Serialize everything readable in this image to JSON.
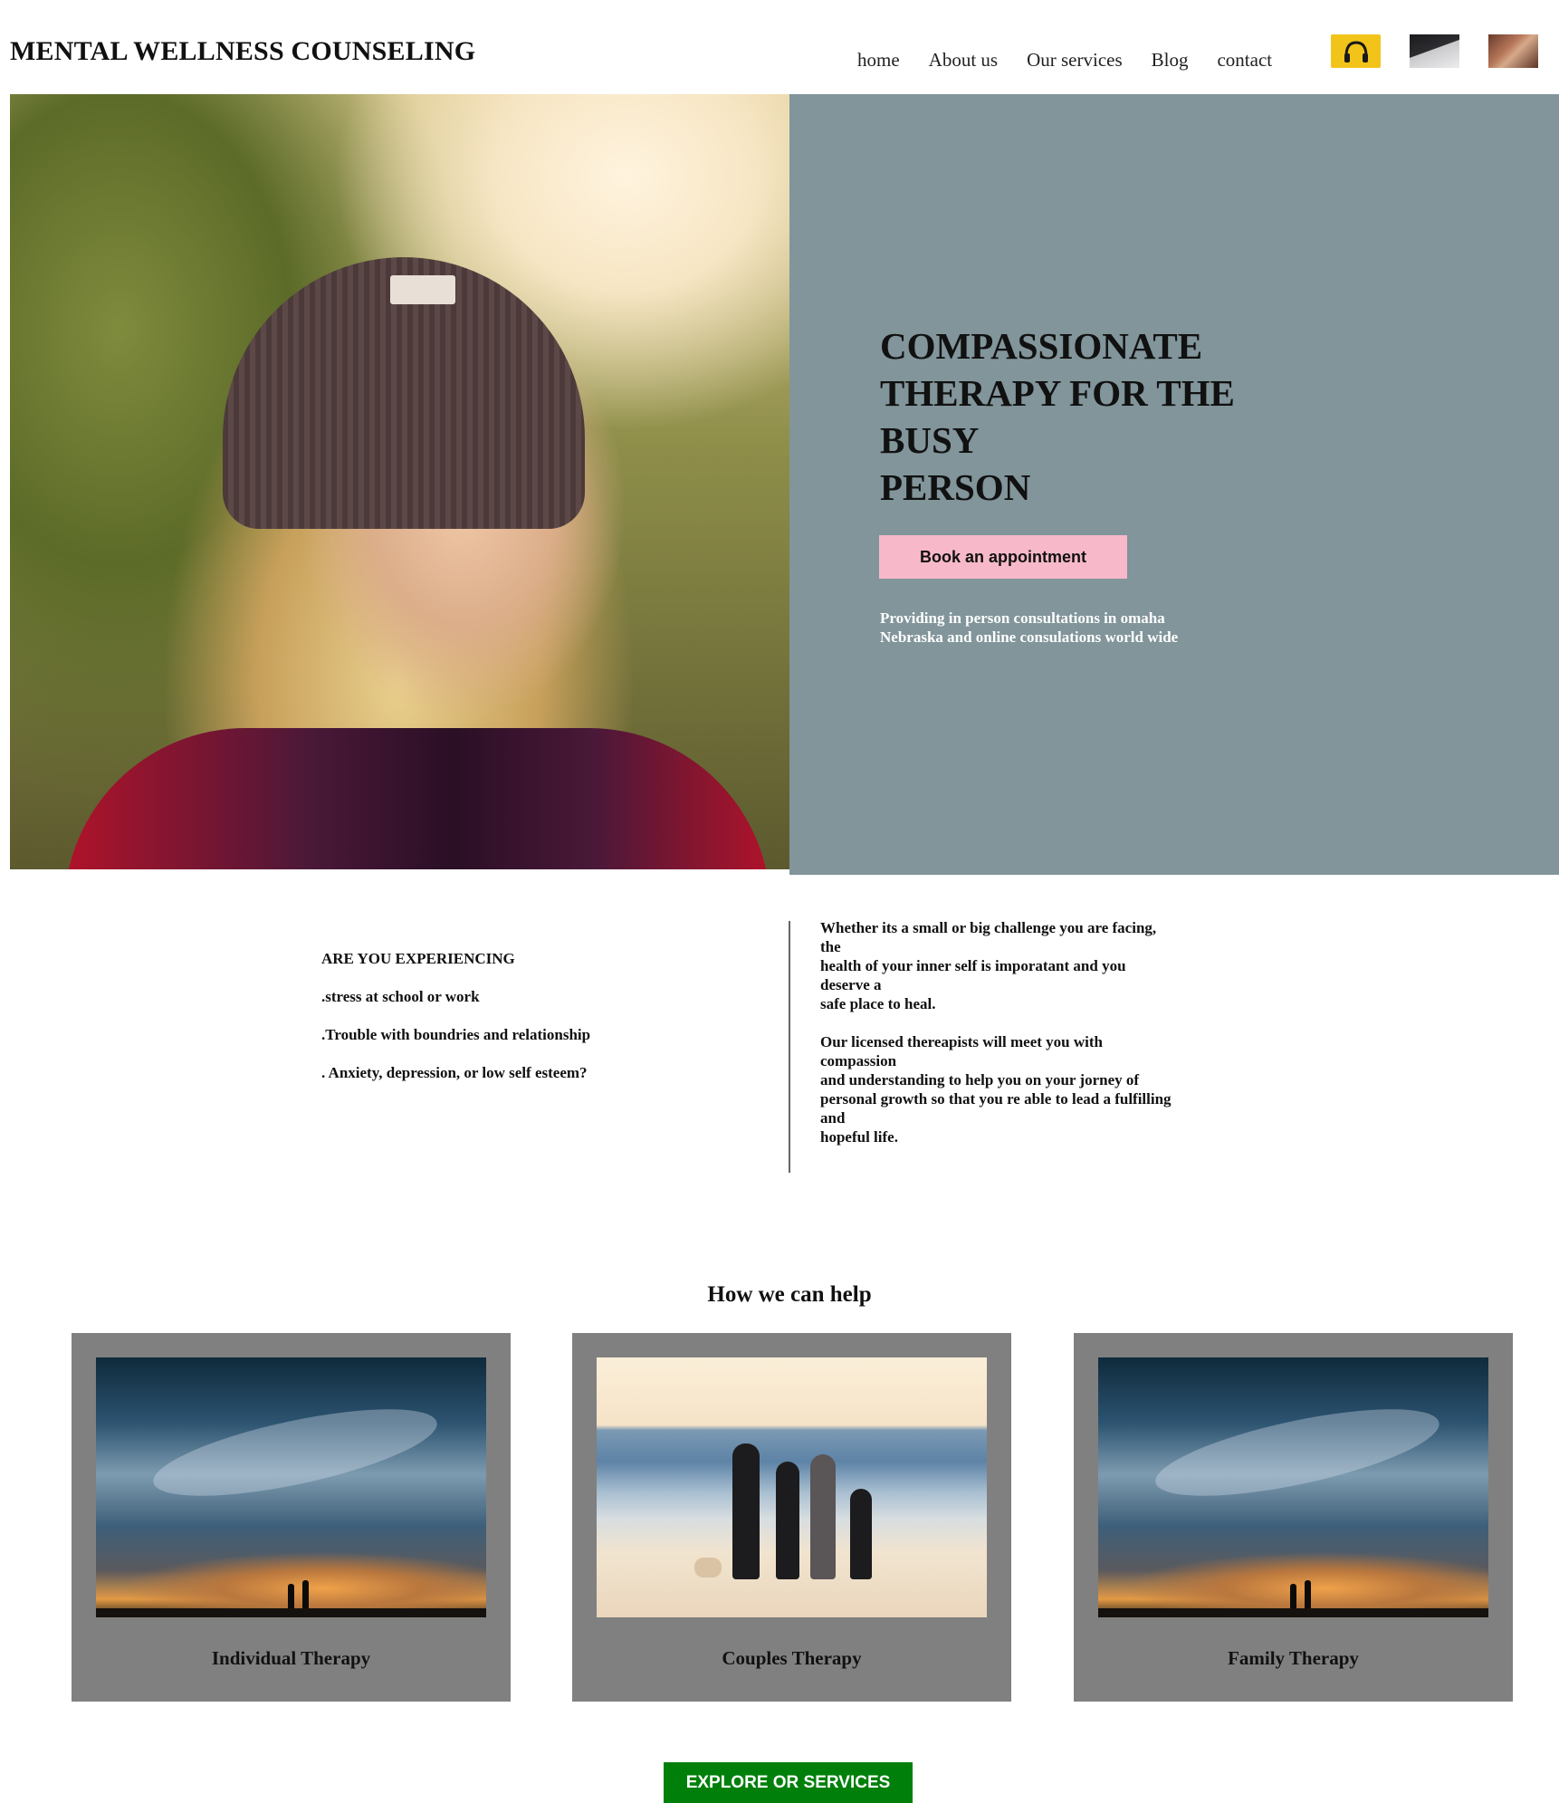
{
  "header": {
    "brand": "MENTAL WELLNESS COUNSELING",
    "nav": [
      "home",
      "About us",
      "Our services",
      "Blog",
      "contact"
    ],
    "thumbnails": [
      "headphones-icon",
      "laptop-icon",
      "photo-icon"
    ]
  },
  "hero": {
    "title_lines": [
      "COMPASSIONATE",
      "THERAPY FOR THE",
      "BUSY",
      "PERSON"
    ],
    "cta": "Book an appointment",
    "subtitle_lines": [
      "Providing in person consultations in omaha",
      "Nebraska and online consulations world wide"
    ]
  },
  "about": {
    "heading": "ARE YOU EXPERIENCING",
    "items": [
      ".stress at school or work",
      ".Trouble with boundries and relationship",
      ". Anxiety, depression, or low self esteem?"
    ],
    "paragraph1_lines": [
      "Whether its a small or big challenge you are facing,",
      "the",
      "health of your inner self is imporatant and you",
      "deserve a",
      "safe place to heal."
    ],
    "paragraph2_lines": [
      "Our licensed thereapists will meet you with",
      "compassion",
      "and understanding to help you on your jorney of",
      "personal growth so that you re able to lead a fulfilling",
      "and",
      "hopeful life."
    ]
  },
  "services": {
    "title": "How we can help",
    "cards": [
      {
        "label": "Individual Therapy"
      },
      {
        "label": "Couples Therapy"
      },
      {
        "label": "Family Therapy"
      }
    ],
    "cta": "EXPLORE OR SERVICES"
  },
  "colors": {
    "hero_panel": "#81959a",
    "book_button": "#f7b9c9",
    "card_bg": "#808080",
    "explore_button": "#00800b"
  }
}
